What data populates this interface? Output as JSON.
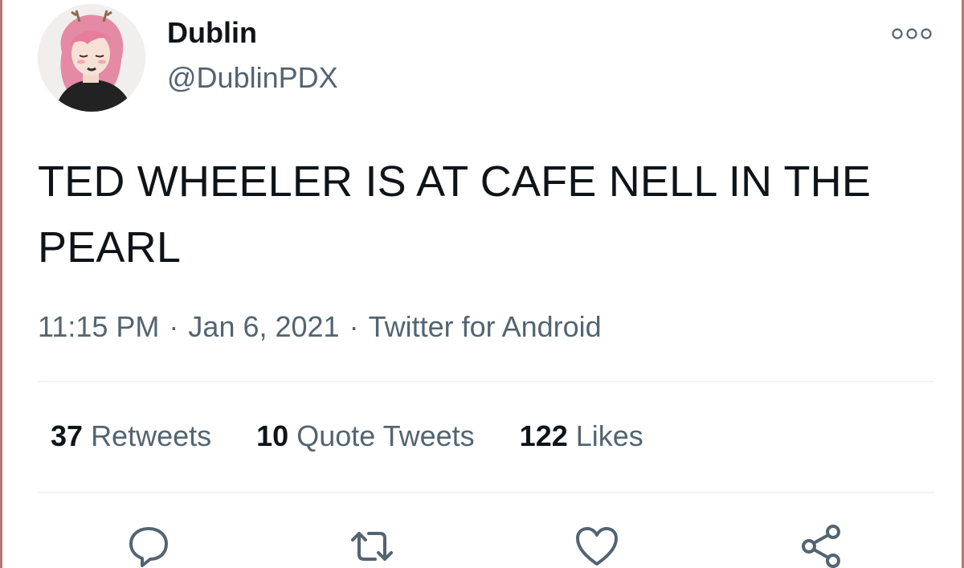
{
  "tweet": {
    "author": {
      "display_name": "Dublin",
      "handle": "@DublinPDX",
      "avatar_icon": "avatar-illustration"
    },
    "text": "TED WHEELER IS AT CAFE NELL IN THE PEARL",
    "meta": {
      "time": "11:15 PM",
      "separator": "·",
      "date": "Jan 6, 2021",
      "source": "Twitter for Android"
    },
    "stats": {
      "retweets_count": "37",
      "retweets_label": "Retweets",
      "quotes_count": "10",
      "quotes_label": "Quote Tweets",
      "likes_count": "122",
      "likes_label": "Likes"
    },
    "actions": [
      "reply-icon",
      "retweet-icon",
      "like-icon",
      "share-icon"
    ]
  },
  "colors": {
    "primary_text": "#0f1419",
    "secondary_text": "#536471",
    "divider": "#eff3f4",
    "frame_border": "#b07a72"
  }
}
